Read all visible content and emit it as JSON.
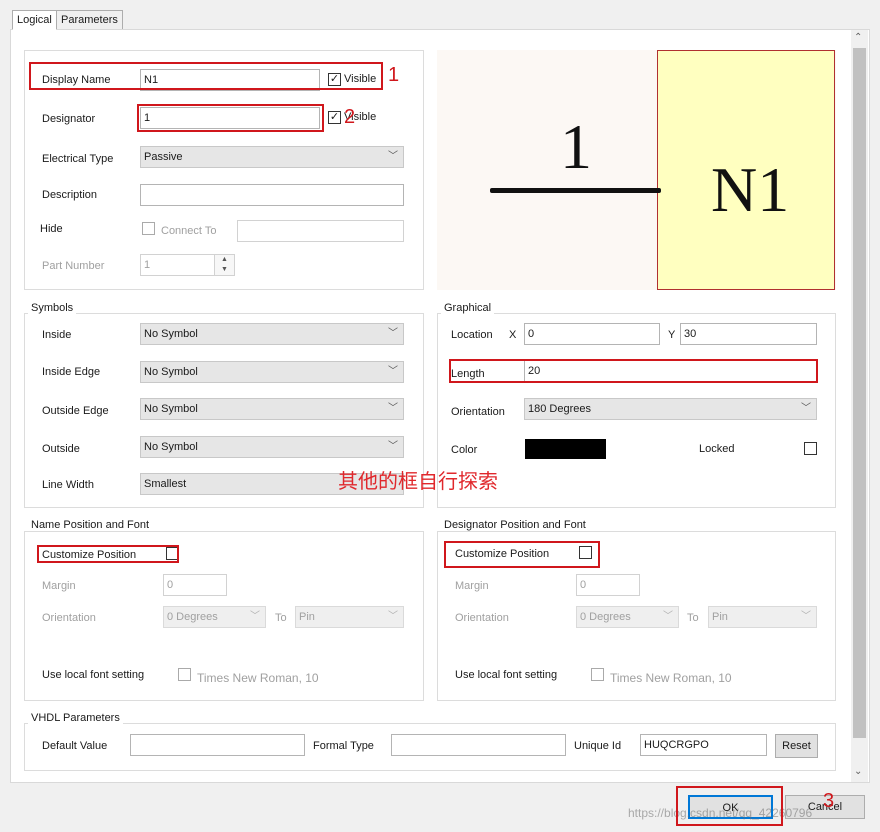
{
  "tabs": [
    "Logical",
    "Parameters"
  ],
  "pin": {
    "display_name_label": "Display Name",
    "display_name_value": "N1",
    "display_name_visible_label": "Visible",
    "designator_label": "Designator",
    "designator_value": "1",
    "designator_visible_label": "Visible",
    "electrical_type_label": "Electrical Type",
    "electrical_type_value": "Passive",
    "description_label": "Description",
    "description_value": "",
    "hide_label": "Hide",
    "connect_to_label": "Connect To",
    "part_number_label": "Part Number",
    "part_number_value": "1"
  },
  "preview": {
    "designator_text": "1",
    "name_text": "N1",
    "body_color": "#ffffc0"
  },
  "symbols": {
    "title": "Symbols",
    "rows": [
      {
        "label": "Inside",
        "value": "No Symbol"
      },
      {
        "label": "Inside Edge",
        "value": "No Symbol"
      },
      {
        "label": "Outside Edge",
        "value": "No Symbol"
      },
      {
        "label": "Outside",
        "value": "No Symbol"
      },
      {
        "label": "Line Width",
        "value": "Smallest"
      }
    ]
  },
  "graphical": {
    "title": "Graphical",
    "location_label": "Location",
    "x_label": "X",
    "x_value": "0",
    "y_label": "Y",
    "y_value": "30",
    "length_label": "Length",
    "length_value": "20",
    "orientation_label": "Orientation",
    "orientation_value": "180 Degrees",
    "color_label": "Color",
    "color_value": "#000000",
    "locked_label": "Locked"
  },
  "annotation_text": "其他的框自行探索",
  "name_pos": {
    "title": "Name Position and Font",
    "customize_label": "Customize Position",
    "margin_label": "Margin",
    "margin_value": "0",
    "orientation_label": "Orientation",
    "orientation_value": "0 Degrees",
    "to_label": "To",
    "to_value": "Pin",
    "local_font_label": "Use local font setting",
    "font_value": "Times New Roman, 10"
  },
  "des_pos": {
    "title": "Designator Position and Font",
    "customize_label": "Customize Position",
    "margin_label": "Margin",
    "margin_value": "0",
    "orientation_label": "Orientation",
    "orientation_value": "0 Degrees",
    "to_label": "To",
    "to_value": "Pin",
    "local_font_label": "Use local font setting",
    "font_value": "Times New Roman, 10"
  },
  "vhdl": {
    "title": "VHDL Parameters",
    "default_value_label": "Default Value",
    "formal_type_label": "Formal Type",
    "unique_id_label": "Unique Id",
    "unique_id_value": "HUQCRGPO",
    "reset_label": "Reset"
  },
  "markers": [
    "1",
    "2",
    "3"
  ],
  "footer": {
    "ok_label": "OK",
    "cancel_label": "Cancel",
    "watermark": "https://blog.csdn.net/qq_42260796"
  }
}
